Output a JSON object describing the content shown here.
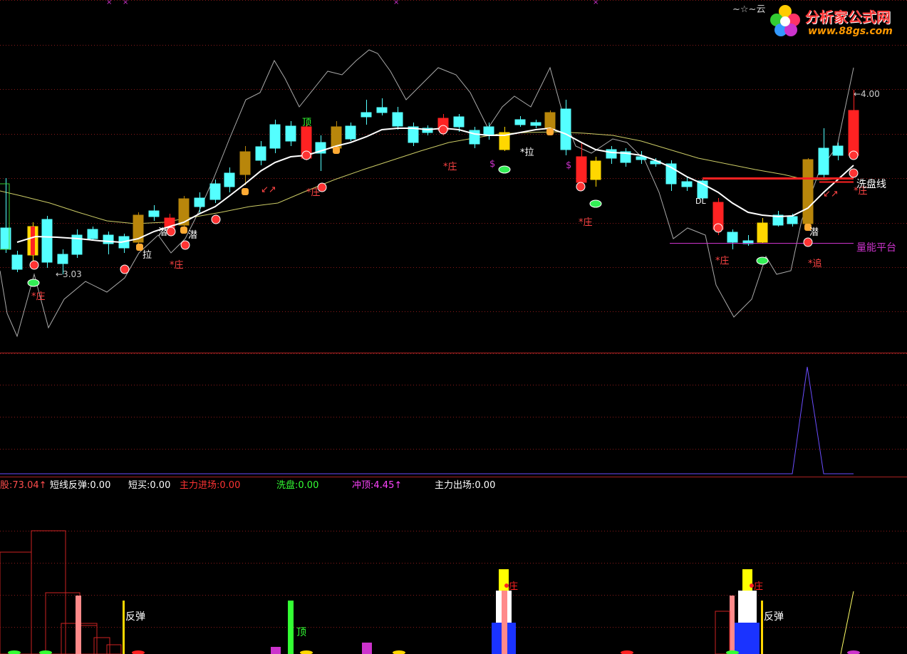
{
  "window": {
    "title": "~☆~云"
  },
  "logo": {
    "name": "分析家公式网",
    "url": "www.88gs.com"
  },
  "colors": {
    "up": "#ff3333",
    "down": "#54ffff",
    "gold": "#b8860b",
    "yellow": "#ffff00",
    "ma_white": "#ffffff",
    "ma_yellow": "#cccc66",
    "band": "#aaaaaa",
    "grid": "#8a1a1a",
    "magenta": "#cc33cc",
    "green": "#33ff33",
    "purple": "#6a4dff"
  },
  "main_panel": {
    "price_low_label": "3.03",
    "price_high_label": "4.00",
    "wash_line_label": "洗盘线",
    "volume_platform_label": "量能平台",
    "signal_labels": {
      "zhuang": "*庄",
      "la": "拉",
      "la_star": "*拉",
      "qian": "潜",
      "zhui": "*追",
      "ding": "顶",
      "dollar": "$",
      "dl": "DL"
    }
  },
  "readouts": {
    "items": [
      {
        "label": "股:",
        "value": "73.04",
        "arrow": "↑",
        "color": "#ff4d4d"
      },
      {
        "label": "短线反弹:",
        "value": "0.00",
        "arrow": "",
        "color": "#ffffff"
      },
      {
        "label": "短买:",
        "value": "0.00",
        "arrow": "",
        "color": "#ffffff"
      },
      {
        "label": "主力进场:",
        "value": "0.00",
        "arrow": "",
        "color": "#ff3333"
      },
      {
        "label": "洗盘:",
        "value": "0.00",
        "arrow": "",
        "color": "#33ff33"
      },
      {
        "label": "冲顶:",
        "value": "4.45",
        "arrow": "↑",
        "color": "#ff44ff"
      },
      {
        "label": "主力出场:",
        "value": "0.00",
        "arrow": "",
        "color": "#ffffff"
      }
    ]
  },
  "bottom_panel": {
    "labels": {
      "rebound": "反弹",
      "top": "顶",
      "zhuang": "庄"
    }
  }
}
